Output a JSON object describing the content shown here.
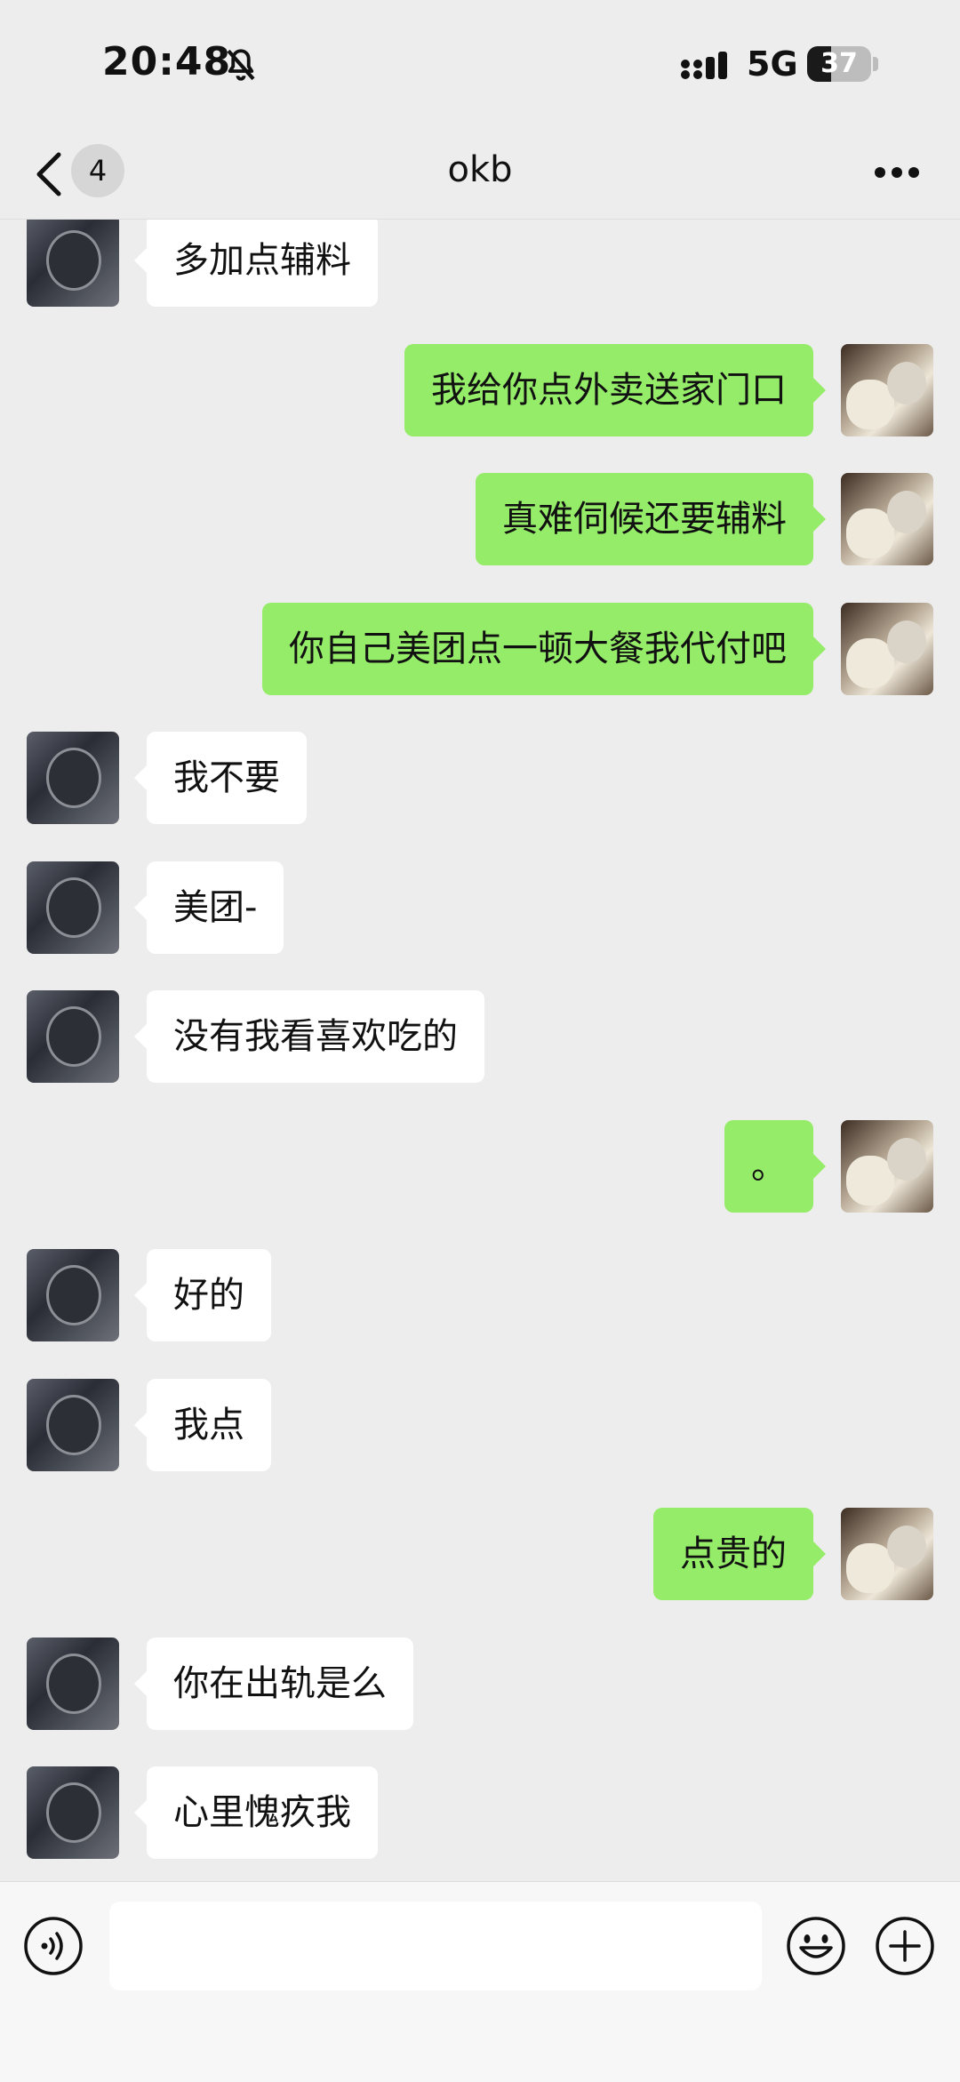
{
  "status_bar": {
    "time": "20:48",
    "network": "5G",
    "battery_level": "37",
    "icons": [
      "bell-muted-icon",
      "signal-icon",
      "battery-icon"
    ]
  },
  "nav": {
    "unread_count": "4",
    "title": "okb",
    "icons": [
      "back-icon",
      "more-icon"
    ]
  },
  "messages": [
    {
      "side": "left",
      "text": "多加点辅料"
    },
    {
      "side": "right",
      "text": "我给你点外卖送家门口"
    },
    {
      "side": "right",
      "text": "真难伺候还要辅料"
    },
    {
      "side": "right",
      "text": "你自己美团点一顿大餐我代付吧"
    },
    {
      "side": "left",
      "text": "我不要"
    },
    {
      "side": "left",
      "text": "美团-"
    },
    {
      "side": "left",
      "text": "没有我看喜欢吃的"
    },
    {
      "side": "right",
      "text": "。"
    },
    {
      "side": "left",
      "text": "好的"
    },
    {
      "side": "left",
      "text": "我点"
    },
    {
      "side": "right",
      "text": "点贵的"
    },
    {
      "side": "left",
      "text": "你在出轨是么"
    },
    {
      "side": "left",
      "text": "心里愧疚我"
    }
  ],
  "input_bar": {
    "input_value": "",
    "icons": [
      "voice-icon",
      "emoji-icon",
      "plus-icon"
    ]
  },
  "colors": {
    "background": "#ededed",
    "sent_bubble": "#95ec69",
    "received_bubble": "#ffffff"
  }
}
